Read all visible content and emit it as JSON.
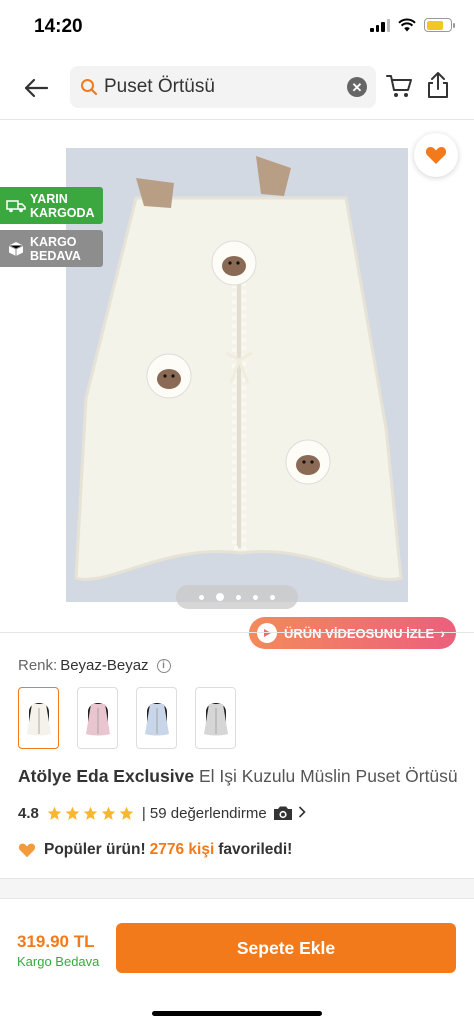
{
  "status_bar": {
    "time": "14:20",
    "battery_level": 0.7
  },
  "header": {
    "search_text": "Puset Örtüsü",
    "icons": [
      "back-arrow-icon",
      "search-icon",
      "clear-icon",
      "cart-icon",
      "share-icon"
    ]
  },
  "badges": {
    "fast_shipping": "YARIN\nKARGODA",
    "free_shipping": "KARGO\nBEDAVA"
  },
  "carousel": {
    "total": 5,
    "active_index": 1
  },
  "video_button": {
    "label": "ÜRÜN VİDEOSUNU İZLE"
  },
  "variant": {
    "label": "Renk:",
    "value": "Beyaz-Beyaz",
    "swatches": [
      {
        "name": "Beyaz-Beyaz",
        "color": "#f4f2ea",
        "selected": true
      },
      {
        "name": "Pembe",
        "color": "#e9c6cf",
        "selected": false
      },
      {
        "name": "Mavi",
        "color": "#c9d6ea",
        "selected": false
      },
      {
        "name": "Gri",
        "color": "#d6d6d6",
        "selected": false
      }
    ]
  },
  "product": {
    "brand": "Atölye Eda Exclusive",
    "name": "El Işi Kuzulu Müslin Puset Örtüsü"
  },
  "rating": {
    "value": "4.8",
    "stars": 5,
    "reviews_text": "| 59 değerlendirme"
  },
  "popular": {
    "title": "Popüler ürün!",
    "count": "2776 kişi",
    "suffix": "favoriledi!"
  },
  "purchase": {
    "price": "319.90 TL",
    "shipping": "Kargo Bedava",
    "button_label": "Sepete Ekle"
  },
  "colors": {
    "brand_orange": "#f27a1a",
    "green": "#3ba73f"
  }
}
